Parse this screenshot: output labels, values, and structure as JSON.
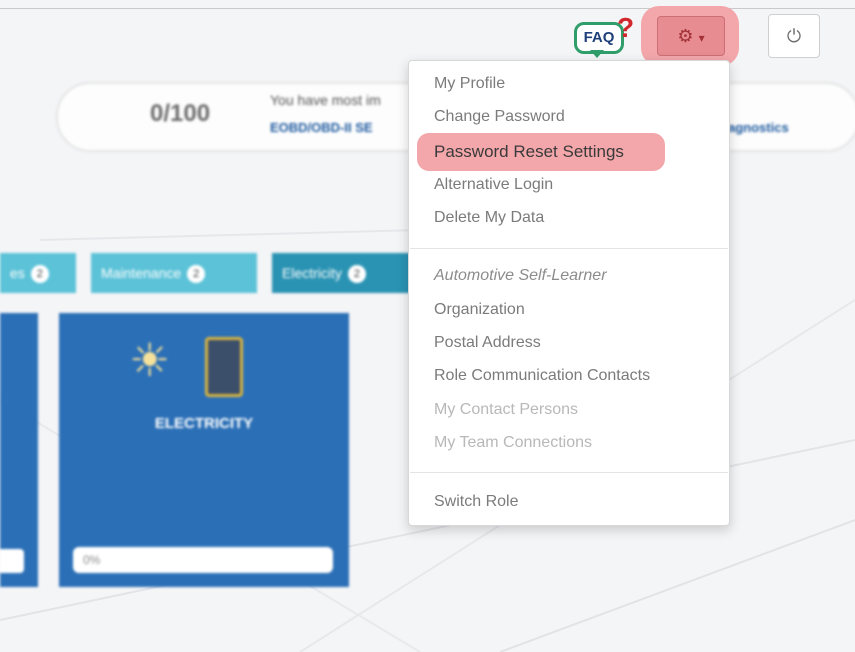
{
  "header": {
    "faq_label": "FAQ",
    "faq_mark": "?",
    "settings_icon": "gear-icon",
    "settings_caret": "▾",
    "power_icon": "power-icon"
  },
  "info": {
    "score": "0/100",
    "message": "You have most im",
    "link_left": "EOBD/OBD-II SE",
    "link_right": "agnostics"
  },
  "tabs": [
    {
      "label": "es",
      "count": "2"
    },
    {
      "label": "Maintenance",
      "count": "2"
    },
    {
      "label": "Electricity",
      "count": "2"
    }
  ],
  "card": {
    "title": "ELECTRICITY",
    "progress": "0%"
  },
  "menu": {
    "items": [
      "My Profile",
      "Change Password",
      "Password Reset Settings",
      "Alternative Login",
      "Delete My Data"
    ],
    "section_header": "Automotive Self-Learner",
    "section_items": [
      "Organization",
      "Postal Address",
      "Role Communication Contacts",
      "My Contact Persons",
      "My Team Connections"
    ],
    "footer_item": "Switch Role"
  },
  "colors": {
    "highlight": "#f3a7ab",
    "card_blue": "#2b6fb6",
    "tab_light": "#5cc2d8",
    "tab_active": "#2a93b3"
  }
}
